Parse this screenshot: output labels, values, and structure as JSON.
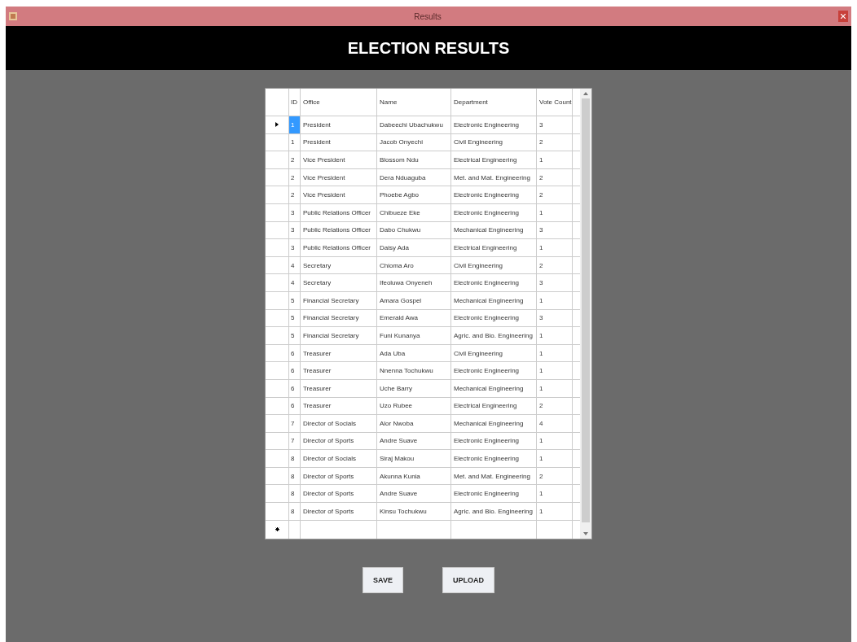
{
  "window": {
    "title": "Results"
  },
  "header": {
    "title": "ELECTION RESULTS"
  },
  "table": {
    "columns": [
      "ID",
      "Office",
      "Name",
      "Department",
      "Vote Count"
    ],
    "rows": [
      {
        "cells": [
          "1",
          "President",
          "Dabeechi Ubachukwu",
          "Electronic Engineering",
          "3"
        ],
        "selected": true
      },
      {
        "cells": [
          "1",
          "President",
          "Jacob Onyechi",
          "Civil Engineering",
          "2"
        ],
        "selected": false
      },
      {
        "cells": [
          "2",
          "Vice President",
          "Blossom Ndu",
          "Electrical Engineering",
          "1"
        ],
        "selected": false
      },
      {
        "cells": [
          "2",
          "Vice President",
          "Dera Nduaguba",
          "Met. and Mat. Engineering",
          "2"
        ],
        "selected": false
      },
      {
        "cells": [
          "2",
          "Vice President",
          "Phoebe Agbo",
          "Electronic Engineering",
          "2"
        ],
        "selected": false
      },
      {
        "cells": [
          "3",
          "Public Relations Officer",
          "Chibueze Eke",
          "Electronic Engineering",
          "1"
        ],
        "selected": false
      },
      {
        "cells": [
          "3",
          "Public Relations Officer",
          "Dabo Chukwu",
          "Mechanical Engineering",
          "3"
        ],
        "selected": false
      },
      {
        "cells": [
          "3",
          "Public Relations Officer",
          "Daisy Ada",
          "Electrical Engineering",
          "1"
        ],
        "selected": false
      },
      {
        "cells": [
          "4",
          "Secretary",
          "Chioma Aro",
          "Civil Engineering",
          "2"
        ],
        "selected": false
      },
      {
        "cells": [
          "4",
          "Secretary",
          "Ifeoluwa Onyeneh",
          "Electronic Engineering",
          "3"
        ],
        "selected": false
      },
      {
        "cells": [
          "5",
          "Financial Secretary",
          "Amara Gospel",
          "Mechanical Engineering",
          "1"
        ],
        "selected": false
      },
      {
        "cells": [
          "5",
          "Financial Secretary",
          "Emerald Awa",
          "Electronic Engineering",
          "3"
        ],
        "selected": false
      },
      {
        "cells": [
          "5",
          "Financial Secretary",
          "Funi Kunanya",
          "Agric. and Bio. Engineering",
          "1"
        ],
        "selected": false
      },
      {
        "cells": [
          "6",
          "Treasurer",
          "Ada Uba",
          "Civil Engineering",
          "1"
        ],
        "selected": false
      },
      {
        "cells": [
          "6",
          "Treasurer",
          "Nnenna Tochukwu",
          "Electronic Engineering",
          "1"
        ],
        "selected": false
      },
      {
        "cells": [
          "6",
          "Treasurer",
          "Uche Barry",
          "Mechanical Engineering",
          "1"
        ],
        "selected": false
      },
      {
        "cells": [
          "6",
          "Treasurer",
          "Uzo Rubee",
          "Electrical Engineering",
          "2"
        ],
        "selected": false
      },
      {
        "cells": [
          "7",
          "Director of Socials",
          "Alor Nwoba",
          "Mechanical Engineering",
          "4"
        ],
        "selected": false
      },
      {
        "cells": [
          "7",
          "Director of Sports",
          "Andre Suave",
          "Electronic Engineering",
          "1"
        ],
        "selected": false
      },
      {
        "cells": [
          "8",
          "Director of Socials",
          "Siraj Makou",
          "Electronic Engineering",
          "1"
        ],
        "selected": false
      },
      {
        "cells": [
          "8",
          "Director of Sports",
          "Akunna Kunia",
          "Met. and Mat. Engineering",
          "2"
        ],
        "selected": false
      },
      {
        "cells": [
          "8",
          "Director of Sports",
          "Andre Suave",
          "Electronic Engineering",
          "1"
        ],
        "selected": false
      },
      {
        "cells": [
          "8",
          "Director of Sports",
          "Kinsu Tochukwu",
          "Agric. and Bio. Engineering",
          "1"
        ],
        "selected": false
      }
    ]
  },
  "buttons": [
    "SAVE",
    "UPLOAD"
  ]
}
